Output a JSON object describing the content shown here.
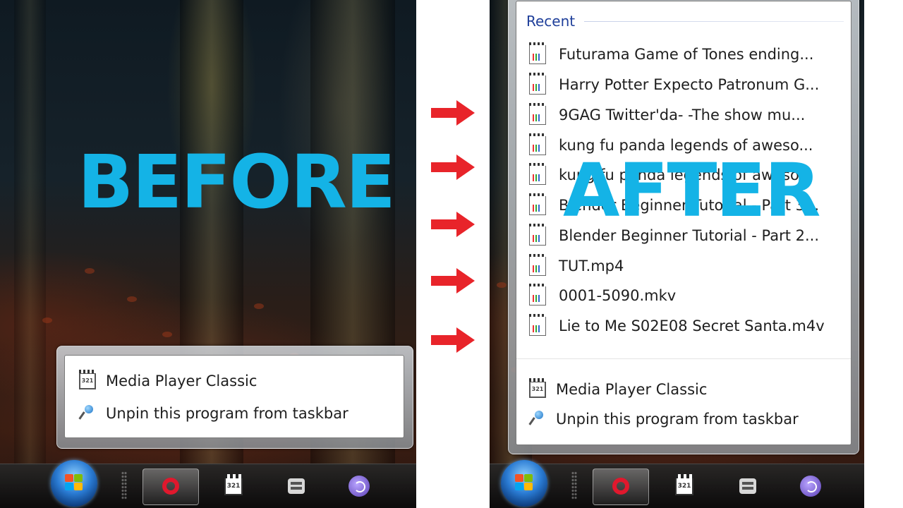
{
  "labels": {
    "before": "BEFORE",
    "after": "AFTER"
  },
  "before_jumplist": {
    "items": [
      {
        "icon": "media-player-classic-icon",
        "label": "Media Player Classic"
      },
      {
        "icon": "unpin-icon",
        "label": "Unpin this program from taskbar"
      }
    ]
  },
  "after_jumplist": {
    "recent_header": "Recent",
    "recent_items": [
      "Futurama Game of Tones ending...",
      "Harry Potter Expecto Patronum G...",
      "9GAG Twitter'da- -The show mu...",
      "kung fu panda legends of aweso...",
      "kung fu panda legends of aweso...",
      "Blender Beginner Tutorial - Part 3...",
      "Blender Beginner Tutorial - Part 2...",
      "TUT.mp4",
      "0001-5090.mkv",
      "Lie to Me S02E08 Secret Santa.m4v"
    ],
    "tasks": [
      {
        "icon": "media-player-classic-icon",
        "label": "Media Player Classic"
      },
      {
        "icon": "unpin-icon",
        "label": "Unpin this program from taskbar"
      }
    ]
  },
  "taskbar_icons": [
    "windows-start-orb",
    "opera-icon",
    "media-player-classic-icon",
    "app-icon",
    "globe-icon"
  ],
  "colors": {
    "label_blue": "#14b3e6",
    "arrow_red": "#e8242a",
    "recent_header": "#1f3f9a"
  }
}
